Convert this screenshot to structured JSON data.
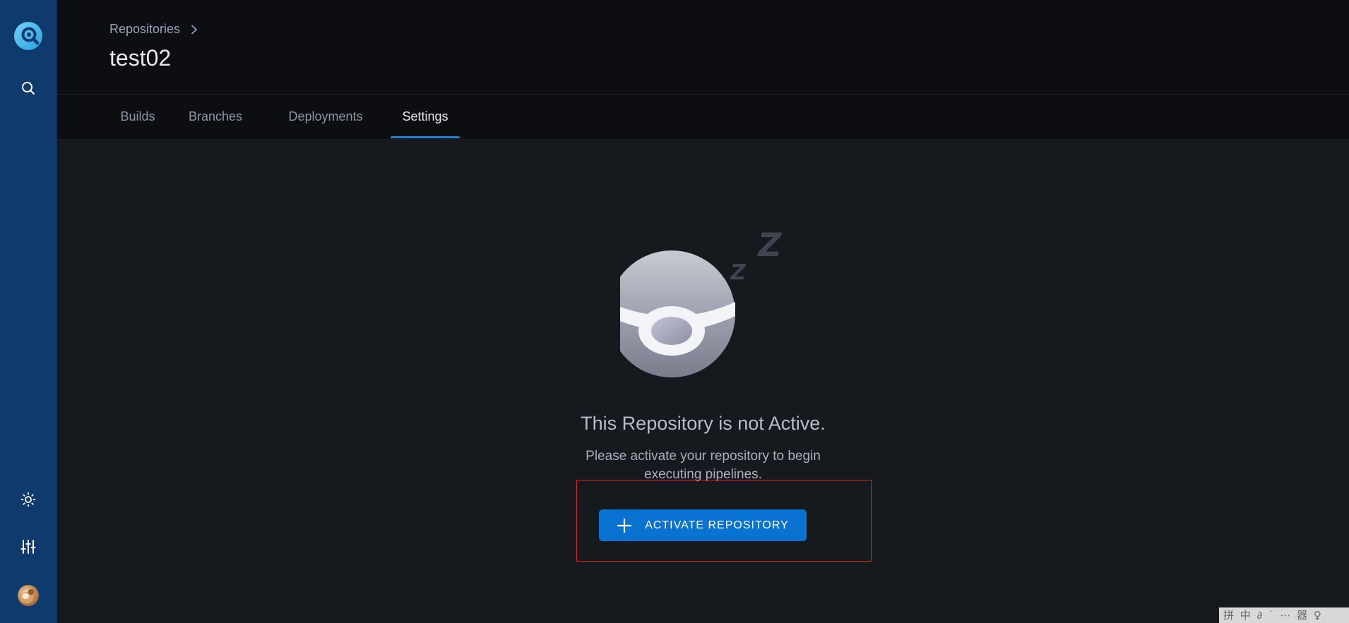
{
  "sidebar": {
    "logo_icon": "drone-logo-icon",
    "search_icon": "search-icon",
    "theme_icon": "sun-icon",
    "settings_icon": "sliders-icon",
    "avatar": "user-avatar"
  },
  "header": {
    "breadcrumb": "Repositories",
    "breadcrumb_separator_icon": "chevron-right-icon",
    "title": "test02"
  },
  "tabs": [
    {
      "label": "Builds",
      "active": false
    },
    {
      "label": "Branches",
      "active": false
    },
    {
      "label": "Deployments",
      "active": false
    },
    {
      "label": "Settings",
      "active": true
    }
  ],
  "empty_state": {
    "illustration": "sleeping-drone-illustration",
    "title": "This Repository is not Active.",
    "description": "Please activate your repository to begin executing pipelines.",
    "button_label": "ACTIVATE REPOSITORY",
    "button_icon": "plus-icon"
  },
  "ime_bar": {
    "text": "拼 中 ∂ ˙ ⋯ 器 ♀"
  },
  "colors": {
    "sidebar": "#0e3a6e",
    "header": "#0c0e12",
    "main": "#161a1f",
    "accent": "#0a73d1",
    "tab_underline": "#1f80d8",
    "highlight": "#e02424"
  }
}
